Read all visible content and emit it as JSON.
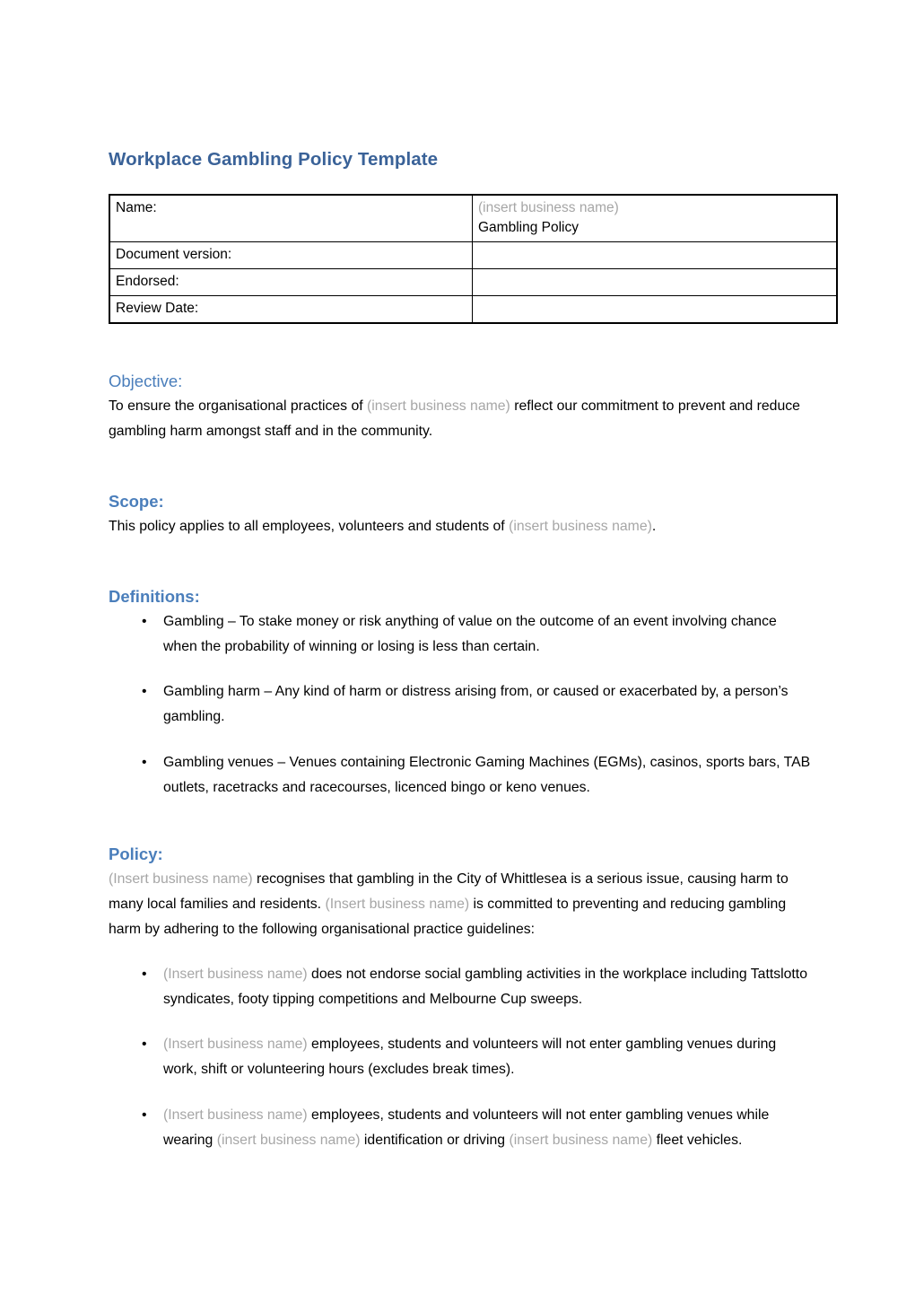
{
  "document": {
    "title": "Workplace Gambling Policy Template",
    "bullet_glyph": "•"
  },
  "meta_table": {
    "rows": [
      {
        "label": "Name:",
        "value_placeholder": "(insert business name)",
        "value_text": "Gambling Policy"
      },
      {
        "label": "Document version:",
        "value_text": ""
      },
      {
        "label": "Endorsed:",
        "value_text": ""
      },
      {
        "label": "Review Date:",
        "value_text": ""
      }
    ]
  },
  "sections": {
    "objective": {
      "heading": "Objective:",
      "para_part1": "To ensure the organisational practices of ",
      "para_placeholder": "(insert business name)",
      "para_part2": " reflect our commitment to prevent and reduce gambling harm amongst staff and in the community."
    },
    "scope": {
      "heading": "Scope:",
      "para_part1": "This policy applies to all employees, volunteers and students of ",
      "para_placeholder": "(insert business name)",
      "para_part2": "."
    },
    "definitions": {
      "heading": "Definitions:",
      "items": [
        "Gambling – To stake money or risk anything of value on the outcome of an event involving chance when the probability of winning or losing is less than certain.",
        "Gambling harm – Any kind of harm or distress arising from, or caused or exacerbated by, a person’s gambling.",
        "Gambling venues – Venues containing Electronic Gaming Machines (EGMs), casinos, sports bars, TAB outlets, racetracks and racecourses, licenced bingo or keno venues."
      ]
    },
    "policy": {
      "heading": "Policy:",
      "intro": {
        "p1_placeholder": "(Insert business name)",
        "p1_text": " recognises that gambling in the City of Whittlesea is a serious issue, causing harm to many local families and residents. ",
        "p2_placeholder": "(Insert business name)",
        "p2_text": " is committed to preventing and reducing gambling harm by adhering to the following organisational practice guidelines:"
      },
      "bullets": [
        {
          "seg1_placeholder": "(Insert business name)",
          "seg1_text": " does not endorse social gambling activities in the workplace including Tattslotto syndicates, footy tipping competitions and Melbourne Cup sweeps."
        },
        {
          "seg1_placeholder": "(Insert business name)",
          "seg1_text": " employees, students and volunteers will not enter gambling venues during work, shift or volunteering hours (excludes break times)."
        },
        {
          "seg1_placeholder": "(Insert business name)",
          "seg1_text": " employees, students and volunteers will not enter gambling venues while wearing ",
          "seg2_placeholder": "(insert business name)",
          "seg2_text": " identification or driving ",
          "seg3_placeholder": "(insert business name)",
          "seg3_text": " fleet vehicles."
        }
      ]
    }
  },
  "colors": {
    "title_blue": "#3a6298",
    "heading_blue": "#4a7ebb",
    "placeholder_gray": "#a6a6a6",
    "body_black": "#000000"
  }
}
